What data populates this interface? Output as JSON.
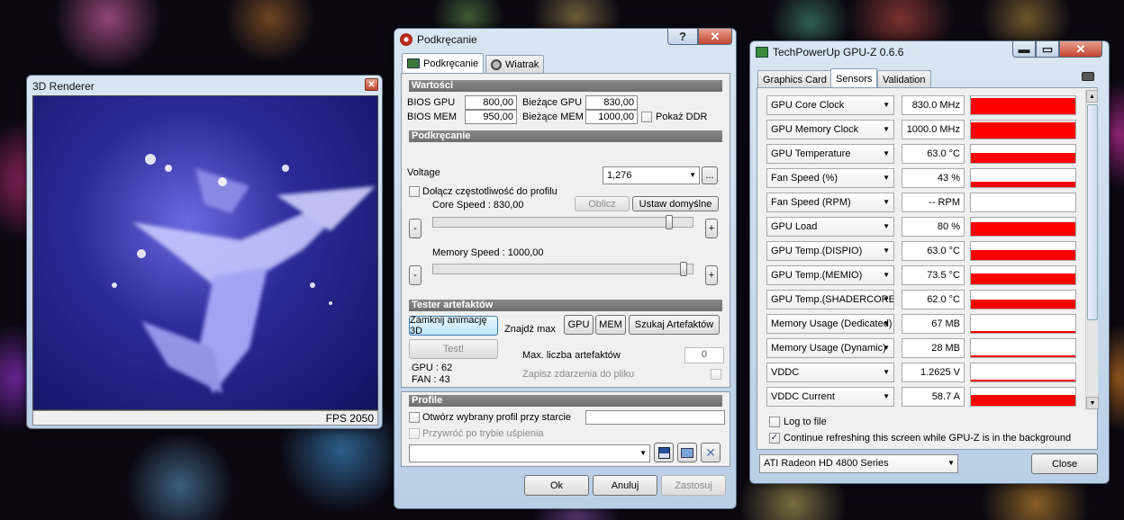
{
  "renderer": {
    "title": "3D Renderer",
    "fps": "FPS 2050"
  },
  "oc": {
    "title": "Podkręcanie",
    "help": "?",
    "close": "✕",
    "tabs": [
      "Podkręcanie",
      "Wiatrak"
    ],
    "values_header": "Wartości",
    "bios_gpu_label": "BIOS GPU",
    "bios_gpu": "800,00",
    "bios_mem_label": "BIOS MEM",
    "bios_mem": "950,00",
    "cur_gpu_label": "Bieżące GPU",
    "cur_gpu": "830,00",
    "cur_mem_label": "Bieżące MEM",
    "cur_mem": "1000,00",
    "show_ddr": "Pokaż DDR",
    "oc_header": "Podkręcanie",
    "voltage_label": "Voltage",
    "voltage": "1,276",
    "more": "...",
    "attach_freq": "Dołącz częstotliwość do profilu",
    "calc": "Oblicz",
    "set_default": "Ustaw domyślne",
    "core_speed": "Core Speed : 830,00",
    "memory_speed": "Memory Speed : 1000,00",
    "minus": "-",
    "plus": "+",
    "core_level": 0.92,
    "memory_level": 0.98,
    "tester_header": "Tester artefaktów",
    "close_anim": "Zamknij animację 3D",
    "find_max": "Znajdź max",
    "gpu_btn": "GPU",
    "mem_btn": "MEM",
    "search_artifacts": "Szukaj Artefaktów",
    "test": "Test!",
    "max_artifacts_label": "Max. liczba artefaktów",
    "max_artifacts": "0",
    "gpu_temp": "GPU : 62",
    "fan": "FAN : 43",
    "save_events": "Zapisz zdarzenia do pliku",
    "profile_header": "Profile",
    "open_profile": "Otwórz wybrany profil przy starcie",
    "restore_sleep": "Przywróć po trybie uśpienia",
    "ok": "Ok",
    "cancel": "Anuluj",
    "apply": "Zastosuj"
  },
  "gpuz": {
    "title": "TechPowerUp GPU-Z 0.6.6",
    "tabs": [
      "Graphics Card",
      "Sensors",
      "Validation"
    ],
    "sensors": [
      {
        "name": "GPU Core Clock",
        "value": "830.0 MHz",
        "level": 0.9
      },
      {
        "name": "GPU Memory Clock",
        "value": "1000.0 MHz",
        "level": 0.9
      },
      {
        "name": "GPU Temperature",
        "value": "63.0 °C",
        "level": 0.55
      },
      {
        "name": "Fan Speed (%)",
        "value": "43 %",
        "level": 0.3
      },
      {
        "name": "Fan Speed (RPM)",
        "value": "-- RPM",
        "level": 0
      },
      {
        "name": "GPU Load",
        "value": "80 %",
        "level": 0.75
      },
      {
        "name": "GPU Temp.(DISPIO)",
        "value": "63.0 °C",
        "level": 0.55
      },
      {
        "name": "GPU Temp.(MEMIO)",
        "value": "73.5 °C",
        "level": 0.6
      },
      {
        "name": "GPU Temp.(SHADERCORE)",
        "value": "62.0 °C",
        "level": 0.5
      },
      {
        "name": "Memory Usage (Dedicated)",
        "value": "67 MB",
        "level": 0.1
      },
      {
        "name": "Memory Usage (Dynamic)",
        "value": "28 MB",
        "level": 0.08
      },
      {
        "name": "VDDC",
        "value": "1.2625 V",
        "level": 0.08
      },
      {
        "name": "VDDC Current",
        "value": "58.7 A",
        "level": 0.6
      }
    ],
    "log_to_file": "Log to file",
    "continue_refresh": "Continue refreshing this screen while GPU-Z is in the background",
    "card": "ATI Radeon HD 4800 Series",
    "close": "Close"
  }
}
